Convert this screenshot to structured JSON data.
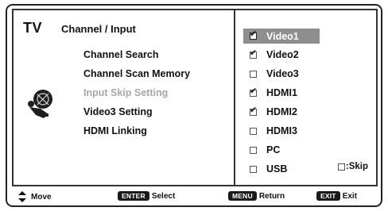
{
  "header": {
    "brand": "TV",
    "section_title": "Channel / Input"
  },
  "left_menu": [
    {
      "label": "Channel Search",
      "disabled": false
    },
    {
      "label": "Channel Scan Memory",
      "disabled": false
    },
    {
      "label": "Input Skip Setting",
      "disabled": true
    },
    {
      "label": "Video3 Setting",
      "disabled": false
    },
    {
      "label": "HDMI Linking",
      "disabled": false
    }
  ],
  "inputs": [
    {
      "label": "Video1",
      "checked": true,
      "selected": true
    },
    {
      "label": "Video2",
      "checked": true,
      "selected": false
    },
    {
      "label": "Video3",
      "checked": false,
      "selected": false
    },
    {
      "label": "HDMI1",
      "checked": true,
      "selected": false
    },
    {
      "label": "HDMI2",
      "checked": true,
      "selected": false
    },
    {
      "label": "HDMI3",
      "checked": false,
      "selected": false
    },
    {
      "label": "PC",
      "checked": false,
      "selected": false
    },
    {
      "label": "USB",
      "checked": false,
      "selected": false
    }
  ],
  "skip_legend": ":Skip",
  "footer": {
    "move_label": "Move",
    "enter_key": "ENTER",
    "enter_label": "Select",
    "menu_key": "MENU",
    "menu_label": "Return",
    "exit_key": "EXIT",
    "exit_label": "Exit"
  }
}
